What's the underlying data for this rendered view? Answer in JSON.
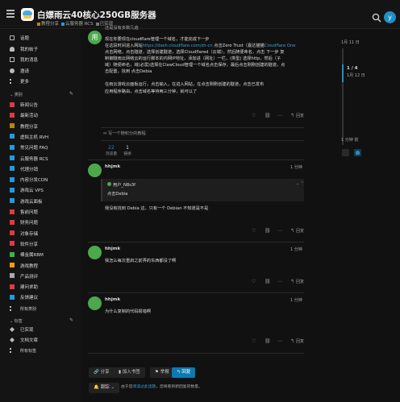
{
  "header": {
    "title": "白嫖雨云40核心250GB服务器",
    "crumbs": [
      {
        "label": "教程分享",
        "color": "#b8860b"
      },
      {
        "label": "云服务器 RCS",
        "color": "#1f9be0"
      },
      {
        "label": "已实现",
        "color": "#777"
      }
    ],
    "avatar_letter": "y"
  },
  "sidebar": {
    "top": [
      {
        "label": "话题",
        "icon": "layers-icon"
      },
      {
        "label": "我的帖子",
        "icon": "user-icon"
      },
      {
        "label": "我的消息",
        "icon": "inbox-icon"
      },
      {
        "label": "邀请",
        "icon": "user-plus-icon"
      },
      {
        "label": "更多",
        "icon": "ellipsis-icon"
      }
    ],
    "categories_label": "类别",
    "categories": [
      {
        "label": "新闻公告",
        "color": "#e5373d"
      },
      {
        "label": "最新活动",
        "color": "#e5373d"
      },
      {
        "label": "教程分享",
        "color": "#b8860b"
      },
      {
        "label": "虚拟主机 RVH",
        "color": "#1f9be0"
      },
      {
        "label": "常见问题 FAQ",
        "color": "#1f9be0"
      },
      {
        "label": "云服务器 RCS",
        "color": "#1f9be0"
      },
      {
        "label": "代理分销",
        "color": "#1f9be0"
      },
      {
        "label": "内容分发CDN",
        "color": "#1f9be0"
      },
      {
        "label": "游戏云 VPS",
        "color": "#1f9be0"
      },
      {
        "label": "游戏云面板",
        "color": "#1f9be0"
      },
      {
        "label": "售前问题",
        "color": "#e5373d"
      },
      {
        "label": "财务问题",
        "color": "#e5373d"
      },
      {
        "label": "对象存储",
        "color": "#e5373d"
      },
      {
        "label": "软件分享",
        "color": "#e5373d"
      },
      {
        "label": "裸金属RBM",
        "color": "#3ab54a"
      },
      {
        "label": "游戏教程",
        "color": "#f39c12"
      },
      {
        "label": "产品测评",
        "color": "#aaaaaa"
      },
      {
        "label": "建问求助",
        "color": "#e5373d"
      },
      {
        "label": "反馈建议",
        "color": "#1f9be0"
      }
    ],
    "all_categories": "所有类别",
    "tags_label": "标签",
    "tags": [
      {
        "label": "已实现"
      },
      {
        "label": "文档文章"
      }
    ],
    "all_tags": "所有标签"
  },
  "post1": {
    "avatar_letter": "用",
    "line0": "还是没有多数几遍",
    "line1": "现在你要现在cloudflare管理一个域名，才能完成下一步",
    "line2a": "在这段时间进入网站",
    "line2_link": "https://dash.cloudflare.com/zh-cn",
    "line2b": " 点击Zero Trust（嘉达猫猫",
    "line2_link2": "Cloudflare One",
    "line3": "点击网络，点击隧道，选择创建隧道，选择Cloudflared（云端），然后随便命名，点击 下一步 复",
    "line4": "制御隧雨云网络云的运行脚本的内网IP地址，添加进（网址）一栏，(类型) 选择http，然后（子",
    "line5": "域）随便命名，域(必需)选择在ClawCloud管理一个域名点击保存，最后点击刚刚创建的隧道，点",
    "line6": "击配置，找到 点击Debia",
    "line7": "在雨云游戏云面板运行，点击输入，在进入网站，在点击刚刚创建的隧道，点击已发布",
    "line8": "应用程序路由，点击域名等待两三分钟，就可以了",
    "reply": "回复",
    "link_count": "写一个随积分的教程",
    "views": "22",
    "views_label": "浏览量",
    "users": "1",
    "users_label": "链接"
  },
  "post2": {
    "username": "hhjmk",
    "time": "1 分钟",
    "quote_user": "用户_N8s3f",
    "quote_text": "点击Debia",
    "body": "我没有找到 Debia 这，只有一个 Debian 不知道是不是",
    "reply": "回复"
  },
  "post3": {
    "username": "hhjmk",
    "time": "1 分钟",
    "body": "我怎么每次重启之前弄的东西都没了啊",
    "reply": "回复"
  },
  "post4": {
    "username": "hhjmk",
    "time": "1 分钟",
    "body": "为什么复制的代码报错啊",
    "reply": "回复"
  },
  "footer": {
    "share": "分享",
    "bookmark": "加入书签",
    "flag": "举报",
    "reply": "回复",
    "tracking": "跟踪",
    "tracking_note_a": "由于您",
    "tracking_link": "阅读过此话题",
    "tracking_note_b": "，您将看到新回复的数量。"
  },
  "timeline": {
    "top_date": "1月 11 日",
    "position": "1 / 4",
    "position_date": "1月 12 日",
    "bottom_time": "1 分钟 前"
  }
}
